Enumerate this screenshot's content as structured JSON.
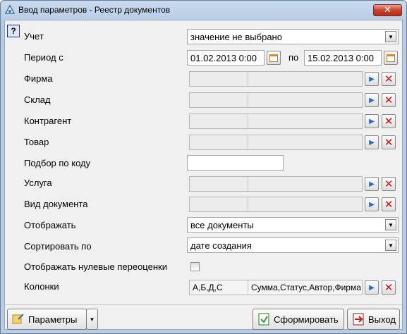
{
  "window": {
    "title": "Ввод параметров - Реестр документов",
    "close_label": "✕"
  },
  "help": {
    "label": "?"
  },
  "labels": {
    "uchet": "Учет",
    "period": "Период с",
    "po": "по",
    "firma": "Фирма",
    "sklad": "Склад",
    "kontragent": "Контрагент",
    "tovar": "Товар",
    "podbor": "Подбор по коду",
    "usluga": "Услуга",
    "vid": "Вид документа",
    "otobrazhat": "Отображать",
    "sort": "Сортировать по",
    "nulevye": "Отображать нулевые переоценки",
    "kolonki": "Колонки"
  },
  "values": {
    "uchet": "значение не выбрано",
    "date_from": "01.02.2013 0:00",
    "date_to": "15.02.2013 0:00",
    "podbor": "",
    "otobrazhat": "все документы",
    "sort": "дате создания",
    "kolonki_1": "А,Б,Д,С",
    "kolonki_2": "Сумма,Статус,Автор,Фирма"
  },
  "buttons": {
    "parametry": "Параметры",
    "sformirovat": "Сформировать",
    "vyhod": "Выход"
  }
}
